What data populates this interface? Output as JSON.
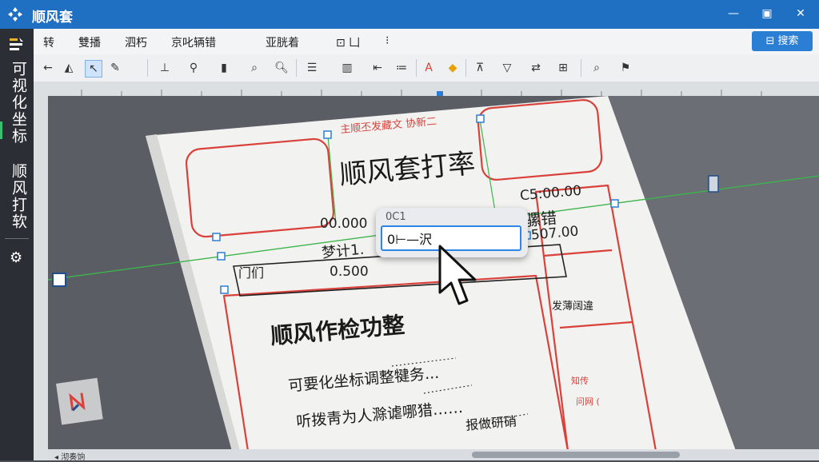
{
  "app": {
    "title": "顺风套",
    "colors": {
      "titlebar": "#1f6fc2",
      "accent": "#2a7fd4",
      "sidebar": "#2b2f35",
      "stamp_red": "#d9413a",
      "guide_green": "#3bb54a"
    }
  },
  "window_controls": {
    "minimize": "—",
    "restore": "▣",
    "close": "✕"
  },
  "sidebar": {
    "items": [
      {
        "label": "可视化坐标",
        "active": true
      },
      {
        "label": "顺风打软",
        "active": false
      }
    ],
    "settings_icon": "gear-icon"
  },
  "menu": {
    "items": [
      "转",
      "雙播",
      "泗朽",
      "京叱辆错",
      "亚胱着",
      "⊡ 凵",
      "⁝"
    ],
    "search_label": "⊟ 搜索"
  },
  "toolbar": {
    "icons": [
      "back-arrow-icon",
      "fill-bucket-icon",
      "select-icon",
      "pen-icon",
      "align-icon",
      "brush-icon",
      "marker-icon",
      "zoom-icon",
      "magnify-icon",
      "list-icon",
      "column-icon",
      "indent-icon",
      "bullets-icon",
      "text-color-icon",
      "highlight-icon",
      "stamp-icon",
      "filter-icon",
      "swap-icon",
      "layout-icon",
      "search-icon",
      "pin-icon"
    ]
  },
  "document": {
    "header_red": "主顺丕发藏文  协新二",
    "title": "顺风套打率",
    "value_left_top": "00.000",
    "value_right_top": "C5:00.00",
    "value_right_mid": "骡错",
    "value_right_low": "507.00",
    "label_small": "梦计1.",
    "left_label": "门们",
    "value_mid": "0.500",
    "section_title": "顺风作检功整",
    "line1": "可要化坐标调整犍务...",
    "line2": "听拨靑为人滁谑哪猎……",
    "line3": "报做研硝",
    "right_text1": "发薄阔違",
    "right_text2": "知传",
    "right_text3": "问网 ("
  },
  "popup": {
    "label": "0C1",
    "input_value": "0⊢—沢"
  },
  "statusbar": {
    "text": "◂ 沏奏饷"
  }
}
